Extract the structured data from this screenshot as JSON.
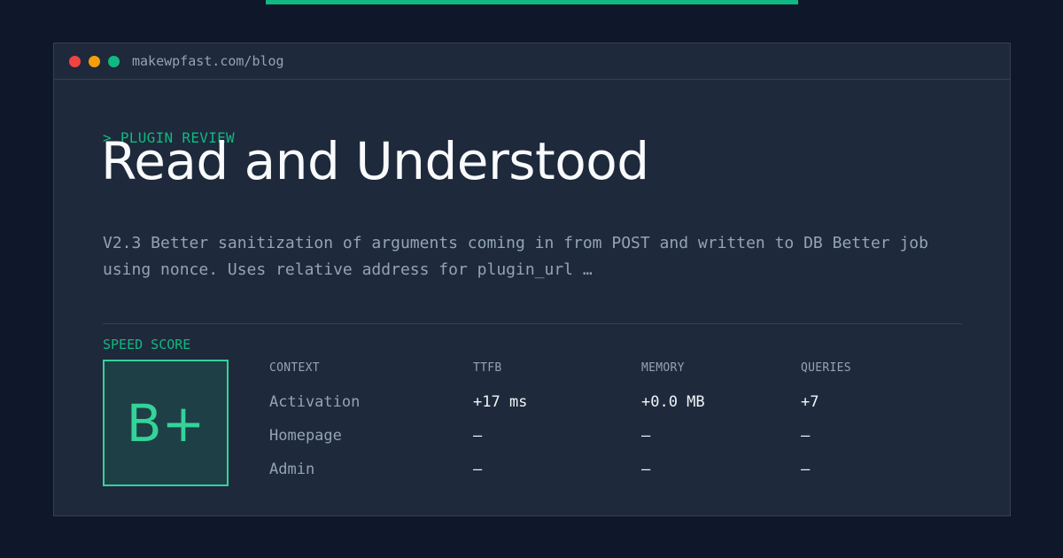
{
  "browser": {
    "url": "makewpfast.com/blog",
    "dots": [
      "#ef4444",
      "#f59e0b",
      "#10b981"
    ]
  },
  "card": {
    "kicker": "> PLUGIN REVIEW",
    "title": "Read and Understood",
    "description": "V2.3 Better sanitization of arguments coming in from POST and written to DB Better job using nonce. Uses relative address for plugin_url …"
  },
  "speed": {
    "label": "SPEED SCORE",
    "grade": "B+"
  },
  "metrics": {
    "headers": [
      "CONTEXT",
      "TTFB",
      "MEMORY",
      "QUERIES"
    ],
    "rows": [
      [
        "Activation",
        "+17 ms",
        "+0.0 MB",
        "+7"
      ],
      [
        "Homepage",
        "—",
        "—",
        "—"
      ],
      [
        "Admin",
        "—",
        "—",
        "—"
      ]
    ]
  },
  "colors": {
    "accent": "#10b981",
    "background": "#0f172a",
    "panel": "#1e293b"
  }
}
